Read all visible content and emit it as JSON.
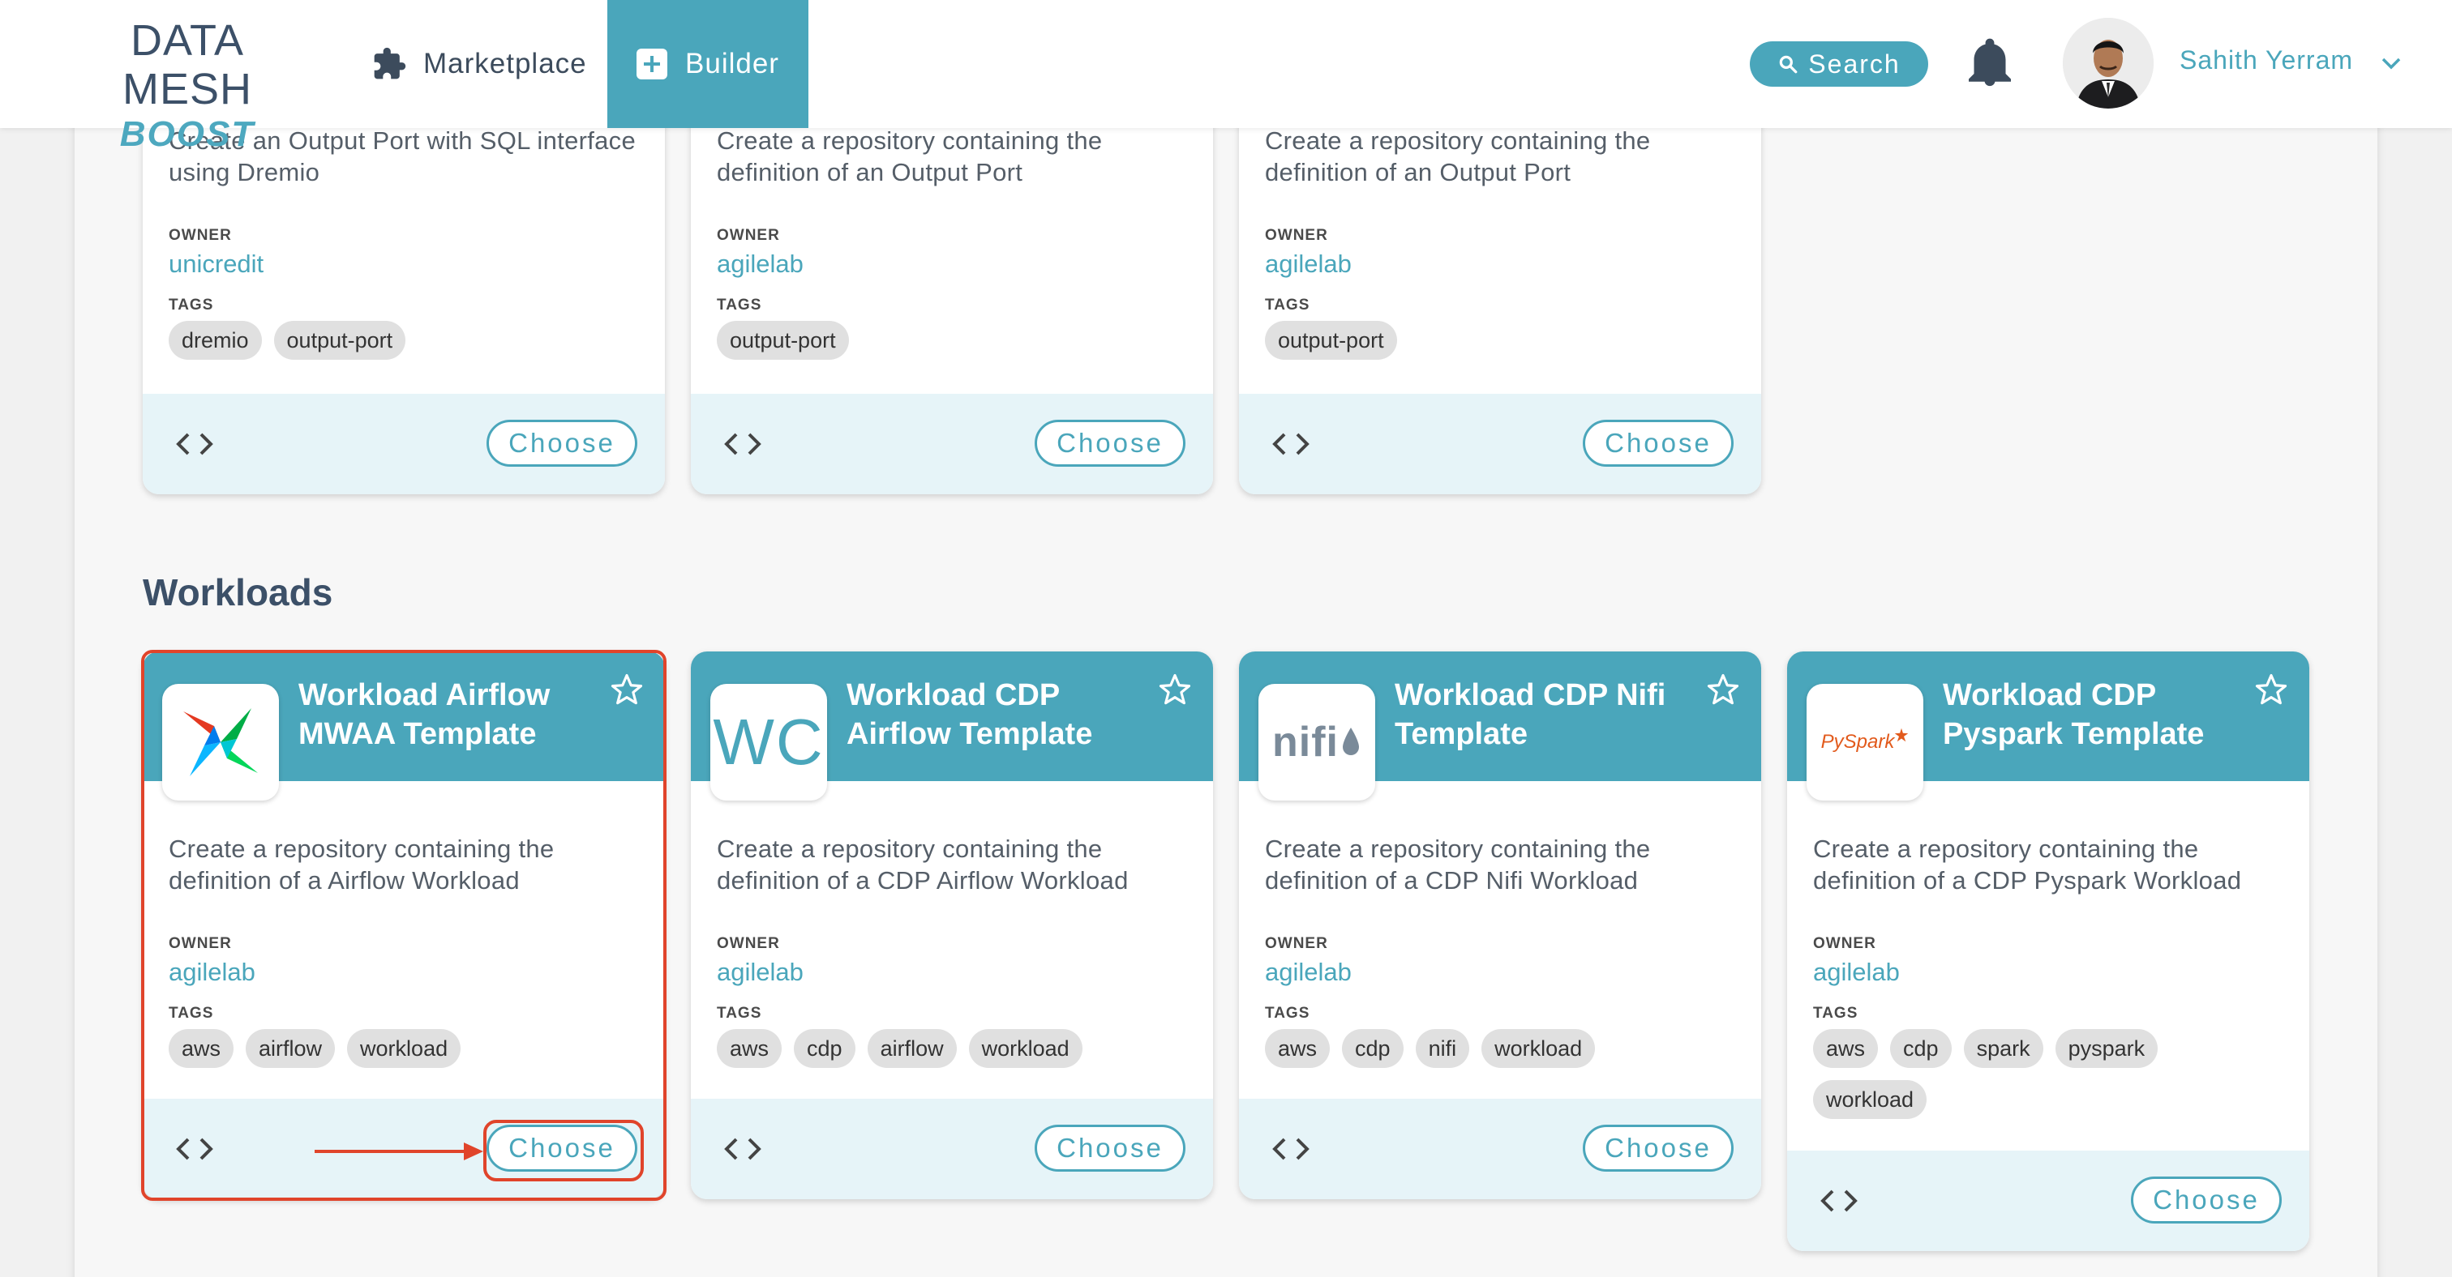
{
  "header": {
    "logo_main": "DATA MESH",
    "logo_sub": "BOOST",
    "nav_marketplace": "Marketplace",
    "nav_builder": "Builder",
    "search_label": "Search",
    "user_name": "Sahith Yerram"
  },
  "labels": {
    "owner": "OWNER",
    "tags": "TAGS",
    "choose": "Choose"
  },
  "top_cards": [
    {
      "description": "Create an Output Port with SQL interface using Dremio",
      "owner": "unicredit",
      "tags": [
        "dremio",
        "output-port"
      ]
    },
    {
      "description": "Create a repository containing the definition of an Output Port",
      "owner": "agilelab",
      "tags": [
        "output-port"
      ]
    },
    {
      "description": "Create a repository containing the definition of an Output Port",
      "owner": "agilelab",
      "tags": [
        "output-port"
      ]
    }
  ],
  "workloads": {
    "section_title": "Workloads",
    "cards": [
      {
        "title": "Workload Airflow MWAA Template",
        "logo": "airflow-logo",
        "description": "Create a repository containing the definition of a Airflow Workload",
        "owner": "agilelab",
        "tags": [
          "aws",
          "airflow",
          "workload"
        ]
      },
      {
        "title": "Workload CDP Airflow Template",
        "logo": "wc-logo",
        "logo_text": "WC",
        "description": "Create a repository containing the definition of a CDP Airflow Workload",
        "owner": "agilelab",
        "tags": [
          "aws",
          "cdp",
          "airflow",
          "workload"
        ]
      },
      {
        "title": "Workload CDP Nifi Template",
        "logo": "nifi-logo",
        "logo_text": "nifi",
        "description": "Create a repository containing the definition of a CDP Nifi Workload",
        "owner": "agilelab",
        "tags": [
          "aws",
          "cdp",
          "nifi",
          "workload"
        ]
      },
      {
        "title": "Workload CDP Pyspark Template",
        "logo": "pyspark-logo",
        "logo_text": "PySpark",
        "description": "Create a repository containing the definition of a CDP Pyspark Workload",
        "owner": "agilelab",
        "tags": [
          "aws",
          "cdp",
          "spark",
          "pyspark",
          "workload"
        ]
      }
    ]
  },
  "colors": {
    "accent": "#4aa6bb",
    "card_footer": "#e6f4f8",
    "highlight": "#e0442b",
    "title_text": "#3c5068"
  }
}
